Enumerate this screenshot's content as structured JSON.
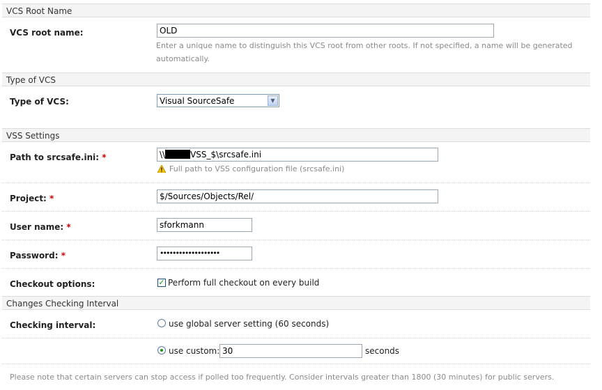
{
  "sections": {
    "vcs_root_name": "VCS Root Name",
    "type_of_vcs": "Type of VCS",
    "vss_settings": "VSS Settings",
    "changes_interval": "Changes Checking Interval"
  },
  "fields": {
    "root_name": {
      "label": "VCS root name:",
      "value": "OLD",
      "hint": "Enter a unique name to distinguish this VCS root from other roots. If not specified, a name will be generated automatically."
    },
    "vcs_type": {
      "label": "Type of VCS:",
      "value": "Visual SourceSafe"
    },
    "srcsafe_path": {
      "label": "Path to srcsafe.ini:",
      "value_prefix": "\\\\",
      "value_suffix": "VSS_$\\srcsafe.ini",
      "hint": "Full path to VSS configuration file (srcsafe.ini)"
    },
    "project": {
      "label": "Project:",
      "value": "$/Sources/Objects/Rel/"
    },
    "username": {
      "label": "User name:",
      "value": "sforkmann"
    },
    "password": {
      "label": "Password:",
      "value": "•••••••••••••••••••"
    },
    "checkout": {
      "label": "Checkout options:",
      "checkbox_label": "Perform full checkout on every build",
      "checked": true
    },
    "interval": {
      "label": "Checking interval:",
      "option_global": "use global server setting (60 seconds)",
      "option_custom": "use custom:",
      "custom_value": "30",
      "unit": "seconds",
      "selected": "custom"
    }
  },
  "required_marker": "*",
  "footer_note": "Please note that certain servers can stop access if polled too frequently. Consider intervals greater than 1800 (30 minutes) for public servers."
}
